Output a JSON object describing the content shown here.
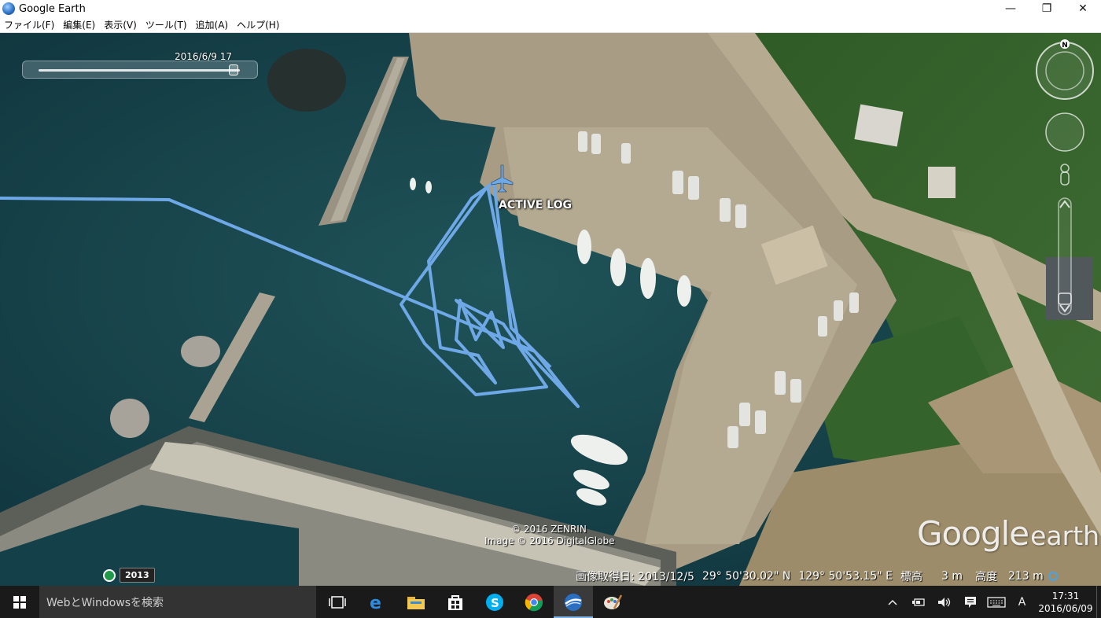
{
  "window": {
    "title": "Google Earth",
    "controls": {
      "minimize": "—",
      "maximize": "❐",
      "close": "✕"
    }
  },
  "menu": {
    "items": [
      {
        "label": "ファイル(F)"
      },
      {
        "label": "編集(E)"
      },
      {
        "label": "表示(V)"
      },
      {
        "label": "ツール(T)"
      },
      {
        "label": "追加(A)"
      },
      {
        "label": "ヘルプ(H)"
      }
    ]
  },
  "map": {
    "time_slider_label": "2016/6/9  17",
    "time_slider_position": 0.97,
    "track_label": "ACTIVE LOG",
    "copyright_line1": "© 2016 ZENRIN",
    "copyright_line2": "Image © 2016 DigitalGlobe",
    "logo_google": "Google",
    "logo_earth": "earth",
    "compass_north": "N",
    "historical_year": "2013",
    "track_color": "#6ea8e6"
  },
  "statusbar": {
    "imagery_date": "画像取得日: 2013/12/5",
    "latitude": "29° 50'30.02\" N",
    "longitude": "129° 50'53.15\" E",
    "elevation_label": "標高",
    "elevation_value": "3 m",
    "altitude_label": "高度",
    "altitude_value": "213 m"
  },
  "taskbar": {
    "search_placeholder": "WebとWindowsを検索",
    "apps": [
      {
        "name": "task-view",
        "icon": "task-view-icon"
      },
      {
        "name": "edge",
        "icon": "edge-icon"
      },
      {
        "name": "file-explorer",
        "icon": "folder-icon"
      },
      {
        "name": "store",
        "icon": "store-icon"
      },
      {
        "name": "skype",
        "icon": "skype-icon"
      },
      {
        "name": "chrome",
        "icon": "chrome-icon"
      },
      {
        "name": "google-earth",
        "icon": "google-earth-icon",
        "active": true
      },
      {
        "name": "paint",
        "icon": "paint-icon"
      }
    ],
    "ime": "A",
    "clock_time": "17:31",
    "clock_date": "2016/06/09"
  }
}
